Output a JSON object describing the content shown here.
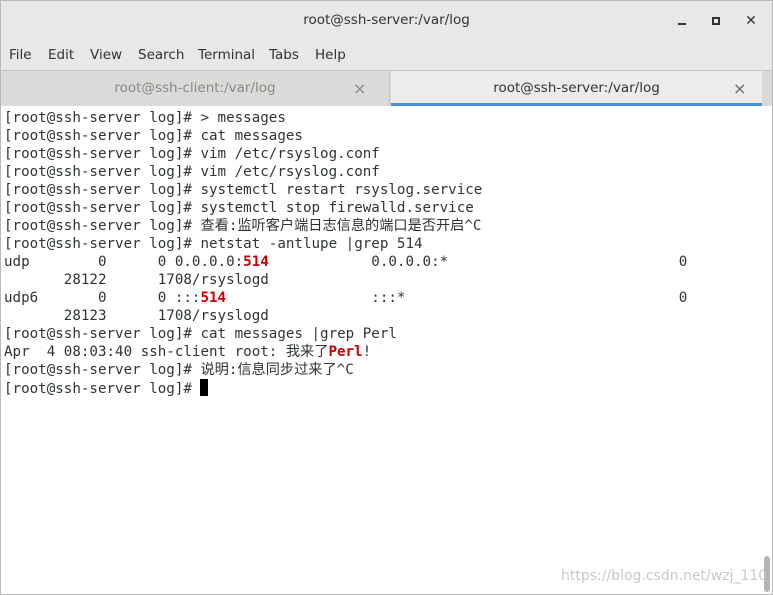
{
  "window": {
    "title": "root@ssh-server:/var/log",
    "minimize_label": "–",
    "close_label": "✕"
  },
  "menu": [
    "File",
    "Edit",
    "View",
    "Search",
    "Terminal",
    "Tabs",
    "Help"
  ],
  "tabs": [
    {
      "label": "root@ssh-client:/var/log",
      "close": "×",
      "active": false
    },
    {
      "label": "root@ssh-server:/var/log",
      "close": "×",
      "active": true
    }
  ],
  "terminal": {
    "lines": [
      "[root@ssh-server log]# > messages",
      "[root@ssh-server log]# cat messages",
      "[root@ssh-server log]# vim /etc/rsyslog.conf",
      "[root@ssh-server log]# vim /etc/rsyslog.conf",
      "[root@ssh-server log]# systemctl restart rsyslog.service",
      "[root@ssh-server log]# systemctl stop firewalld.service",
      "[root@ssh-server log]# 查看:监听客户端日志信息的端口是否开启^C",
      "[root@ssh-server log]# netstat -antlupe |grep 514",
      {
        "pre": "udp        0      0 0.0.0.0:",
        "hl": "514",
        "post": "            0.0.0.0:*                           0"
      },
      "       28122      1708/rsyslogd",
      {
        "pre": "udp6       0      0 :::",
        "hl": "514",
        "post": "                 :::*                                0"
      },
      "       28123      1708/rsyslogd",
      "[root@ssh-server log]# cat messages |grep Perl",
      {
        "pre": "Apr  4 08:03:40 ssh-client root: 我来了",
        "hl": "Perl",
        "post": "!"
      },
      "[root@ssh-server log]# 说明:信息同步过来了^C",
      {
        "prompt": "[root@ssh-server log]# "
      }
    ]
  },
  "watermark": "https://blog.csdn.net/wzj_110",
  "colors": {
    "highlight": "#cc0000",
    "tab_accent": "#4a90d9",
    "chrome_bg": "#e8e8e7"
  }
}
